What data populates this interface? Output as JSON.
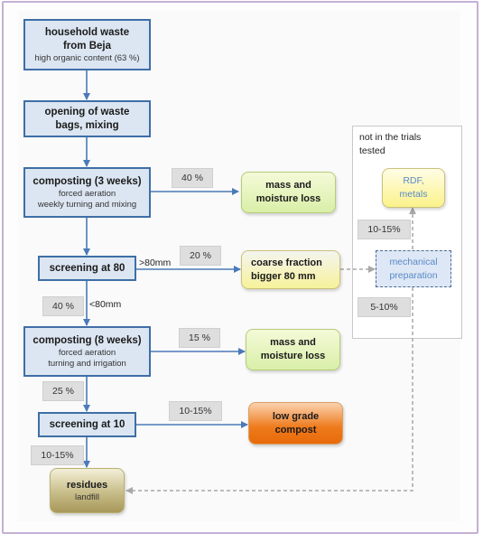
{
  "colors": {
    "step_fill": "#dce6f2",
    "step_border": "#3f6ea6",
    "arrow": "#4a7ab8",
    "dashed_arrow": "#a8a8a8",
    "green_box": "#d9efa8",
    "yellow_box": "#f7f29a",
    "orange_box": "#ee7a1c",
    "olive_box": "#c7bd88",
    "mech_box": "#dde7f5",
    "pct_badge": "#dedede",
    "frame_border": "#c4b0d4"
  },
  "steps": {
    "household": {
      "title": "household waste from Beja",
      "title_line1": "household waste",
      "title_line2": "from Beja",
      "sub": "high organic content (63 %)"
    },
    "opening": {
      "title_line1": "opening of waste",
      "title_line2": "bags, mixing"
    },
    "composting3": {
      "title": "composting (3 weeks)",
      "sub1": "forced aeration",
      "sub2": "weekly turning and mixing"
    },
    "screening80": {
      "title": "screening at 80"
    },
    "composting8": {
      "title": "composting (8 weeks)",
      "sub1": "forced aeration",
      "sub2": "turning and irrigation"
    },
    "screening10": {
      "title": "screening at 10"
    }
  },
  "outputs": {
    "mass_loss_1": {
      "line1": "mass and",
      "line2": "moisture loss"
    },
    "coarse_fraction": {
      "line1": "coarse fraction",
      "line2": "bigger 80 mm"
    },
    "mass_loss_2": {
      "line1": "mass and",
      "line2": "moisture loss"
    },
    "low_grade_compost": {
      "line1": "low grade",
      "line2": "compost"
    },
    "residues": {
      "title": "residues",
      "sub": "landfill"
    },
    "rdf_metals": {
      "line1": "RDF,",
      "line2": "metals"
    },
    "mechanical_prep": {
      "line1": "mechanical",
      "line2": "preparation"
    }
  },
  "region": {
    "label_line1": "not in the trials",
    "label_line2": "tested"
  },
  "percentages": {
    "composting3_loss": "40 %",
    "screening80_coarse": "20 %",
    "screening80_fine": "40 %",
    "composting8_loss": "15 %",
    "composting8_out": "25 %",
    "screening10_compost": "10-15%",
    "screening10_residues": "10-15%",
    "mech_to_rdf": "10-15%",
    "mech_to_residues": "5-10%"
  },
  "edge_labels": {
    "over80": ">80mm",
    "under80": "<80mm"
  }
}
